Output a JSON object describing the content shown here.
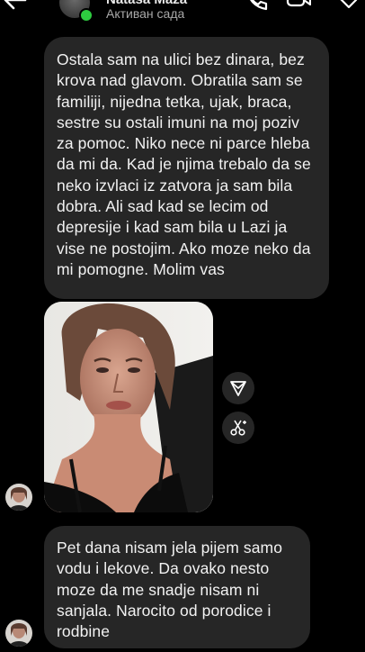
{
  "header": {
    "contact_name": "Nataša Maza",
    "status": "Активан сада",
    "icons": [
      "back-arrow-icon",
      "call-icon",
      "video-call-icon",
      "tag-icon"
    ]
  },
  "messages": [
    {
      "type": "text",
      "text": "Ostala sam na ulici bez dinara, bez krova nad glavom. Obratila sam se familiji, nijedna tetka, ujak, braca, sestre su ostali imuni na moj poziv za pomoc. Niko nece ni parce hleba da mi da. Kad je njima trebalo da se neko izvlaci iz zatvora ja sam bila dobra. Ali sad kad se lecim od depresije i kad sam bila u Lazi ja vise ne postojim. Ako moze neko da mi pomogne. Molim vas"
    },
    {
      "type": "photo"
    },
    {
      "type": "text",
      "text": "Pet dana nisam jela pijem samo vodu i lekove. Da ovako nesto moze da me snadje nisam ni sanjala. Narocito od porodice i rodbine"
    }
  ],
  "colors": {
    "background": "#000000",
    "bubble": "#262626",
    "online": "#2ecc40",
    "secondary_text": "#a8a8a8"
  }
}
